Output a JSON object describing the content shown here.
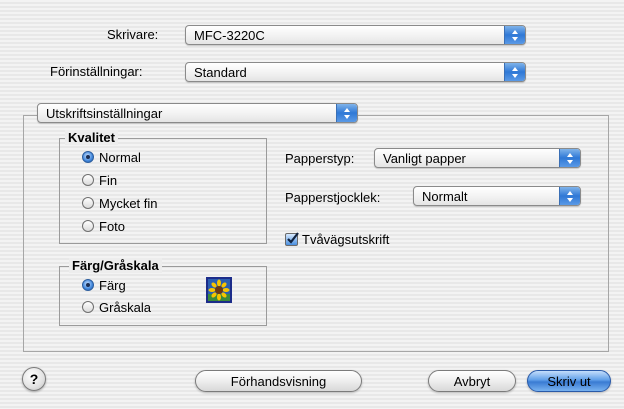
{
  "printer": {
    "label": "Skrivare:",
    "value": "MFC-3220C"
  },
  "presets": {
    "label": "Förinställningar:",
    "value": "Standard"
  },
  "section_popup": {
    "value": "Utskriftsinställningar"
  },
  "quality": {
    "title": "Kvalitet",
    "options": [
      "Normal",
      "Fin",
      "Mycket fin",
      "Foto"
    ],
    "selected": "Normal"
  },
  "color_mode": {
    "title": "Färg/Gråskala",
    "options": [
      "Färg",
      "Gråskala"
    ],
    "selected": "Färg",
    "icon": "sunflower-color-icon"
  },
  "paper_type": {
    "label": "Papperstyp:",
    "value": "Vanligt papper"
  },
  "paper_thickness": {
    "label": "Papperstjocklek:",
    "value": "Normalt"
  },
  "duplex": {
    "label": "Tvåvägsutskrift",
    "checked": true
  },
  "buttons": {
    "help": "?",
    "preview": "Förhandsvisning",
    "cancel": "Avbryt",
    "print": "Skriv ut"
  },
  "colors": {
    "accent": "#3a7bd3",
    "panel_border": "#a6a6a6"
  }
}
